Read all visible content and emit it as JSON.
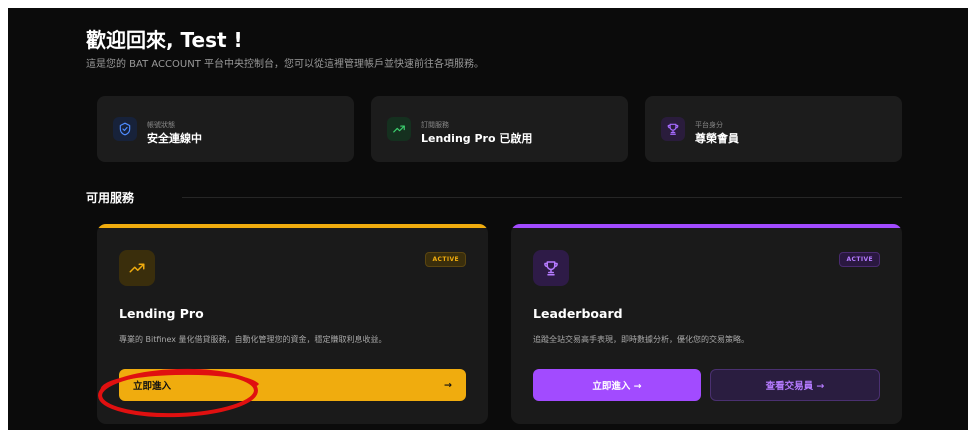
{
  "header": {
    "title": "歡迎回來, Test !",
    "subtitle": "這是您的 BAT ACCOUNT 平台中央控制台，您可以從這裡管理帳戶並快速前往各項服務。"
  },
  "stats": [
    {
      "label": "帳號狀態",
      "value": "安全連線中",
      "icon": "shield-check-icon",
      "color": "#4f8cff"
    },
    {
      "label": "訂閱服務",
      "value": "Lending Pro 已啟用",
      "icon": "trending-up-icon",
      "color": "#3ccf6e"
    },
    {
      "label": "平台身分",
      "value": "尊榮會員",
      "icon": "trophy-icon",
      "color": "#a66bff"
    }
  ],
  "section": {
    "title": "可用服務"
  },
  "services": [
    {
      "title": "Lending Pro",
      "description": "專業的 Bitfinex 量化借貸服務，自動化管理您的資金，穩定賺取利息收益。",
      "badge": "ACTIVE",
      "accent": "#f0ac0e",
      "primary_button": "立即進入",
      "primary_arrow": "→",
      "icon": "trending-up-icon"
    },
    {
      "title": "Leaderboard",
      "description": "追蹤全站交易高手表現，即時數據分析，優化您的交易策略。",
      "badge": "ACTIVE",
      "accent": "#a24bff",
      "primary_button": "立即進入 →",
      "secondary_button": "查看交易員 →",
      "icon": "trophy-icon"
    }
  ],
  "annotation": {
    "shape": "red-ellipse",
    "color": "#e01010"
  }
}
